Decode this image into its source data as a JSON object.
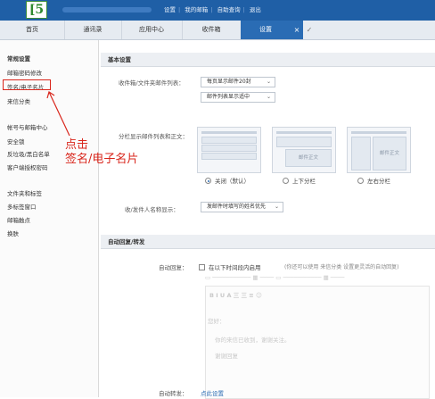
{
  "header": {
    "logo_text": "[5",
    "links": [
      "设置",
      "我的邮箱",
      "自助查询",
      "退出"
    ]
  },
  "tabs": [
    "首页",
    "通讯录",
    "应用中心",
    "收件箱",
    "设置"
  ],
  "tab_close": "×",
  "tab_check": "✓",
  "sidebar": {
    "items": [
      {
        "label": "常规设置",
        "head": true
      },
      {
        "label": "邮箱密码修改"
      },
      {
        "label": "签名/电子名片"
      },
      {
        "label": "来信分类"
      },
      {
        "label": "帐号与邮箱中心"
      },
      {
        "label": "安全锁"
      },
      {
        "label": "反垃圾/黑白名单"
      },
      {
        "label": "客户端授权密码"
      },
      {
        "label": "文件夹和标签"
      },
      {
        "label": "多标签窗口"
      },
      {
        "label": "邮箱触点"
      },
      {
        "label": "换肤"
      }
    ]
  },
  "annotation": {
    "line1": "点击",
    "line2": "签名/电子名片"
  },
  "basic": {
    "title": "基本设置",
    "list_label": "收件箱/文件夹邮件列表：",
    "per_page": "每页显示邮件20封",
    "list_mode": "邮件列表显示适中",
    "split_label": "分栏显示邮件列表和正文：",
    "thumb_text": "邮件正文",
    "radio_off": "关闭（默认）",
    "radio_ud": "上下分栏",
    "radio_lr": "左右分栏",
    "name_label": "收/发件人名称显示：",
    "name_value": "发邮件时填写的姓名优先"
  },
  "auto": {
    "title": "自动回复/转发",
    "reply_label": "自动回复：",
    "reply_check": "在以下时间段内启用",
    "reply_hint": "(你还可以使用 来信分类 设置更灵活的自动回复)",
    "toolbar": "B  I  U  A  三  三  ≡  ☺",
    "editor_lines": [
      "您好：",
      "你的来信已收到，谢谢关注。",
      "谢谢回复"
    ],
    "forward_label": "自动转发：",
    "forward_link": "点此设置"
  }
}
